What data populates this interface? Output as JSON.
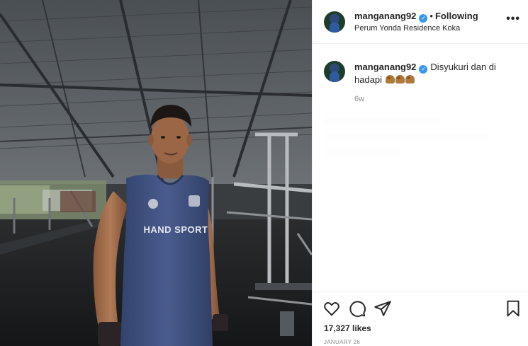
{
  "post": {
    "username": "manganang92",
    "follow_state": "Following",
    "location": "Perum Yonda Residence Koka",
    "caption": "Disyukuri dan di hadapi",
    "caption_emoji": "flexed-biceps-icon",
    "time_ago": "6w",
    "likes": "17,327 likes",
    "date": "JANUARY 26",
    "shirt_text": "HAND SPORT"
  },
  "icons": {
    "verified": "verified-badge-icon",
    "more": "more-options-icon",
    "like": "heart-icon",
    "comment": "comment-icon",
    "share": "share-icon",
    "save": "bookmark-icon"
  },
  "colors": {
    "verified_blue": "#3897f0",
    "text_primary": "#262626",
    "text_secondary": "#8e8e8e",
    "shirt_blue": "#3c4f80"
  }
}
